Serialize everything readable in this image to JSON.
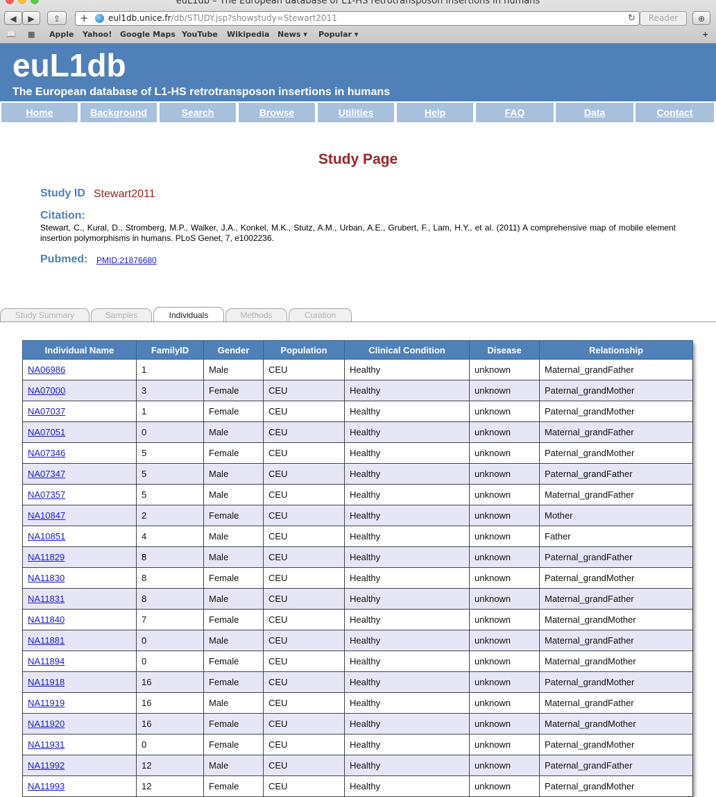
{
  "browser": {
    "window_title": "euL1db – The European database of L1-HS retrotransposon insertions in humans",
    "url_host": "eul1db.unice.fr",
    "url_path": "/db/STUDY.jsp?showstudy=Stewart2011",
    "reader_label": "Reader",
    "bookmarks": [
      "Apple",
      "Yahoo!",
      "Google Maps",
      "YouTube",
      "Wikipedia",
      "News ▾",
      "Popular ▾"
    ]
  },
  "site": {
    "logo": "euL1db",
    "tagline": "The European database of L1-HS retrotransposon insertions in humans"
  },
  "nav": [
    "Home",
    "Background",
    "Search",
    "Browse",
    "Utilities",
    "Help",
    "FAQ",
    "Data",
    "Contact"
  ],
  "study": {
    "page_title": "Study Page",
    "id_label": "Study ID",
    "id_value": "Stewart2011",
    "citation_label": "Citation:",
    "citation_text": "Stewart, C., Kural, D., Stromberg, M.P., Walker, J.A., Konkel, M.K., Stutz, A.M., Urban, A.E., Grubert, F., Lam, H.Y., et al. (2011) A comprehensive map of mobile element insertion polymorphisms in humans. PLoS Genet, 7, e1002236.",
    "pubmed_label": "Pubmed:",
    "pubmed_link": "PMID:21876680"
  },
  "tabs": [
    {
      "label": "Study Summary",
      "active": false
    },
    {
      "label": "Samples",
      "active": false
    },
    {
      "label": "Individuals",
      "active": true
    },
    {
      "label": "Methods",
      "active": false
    },
    {
      "label": "Curation",
      "active": false
    }
  ],
  "table": {
    "columns": [
      "Individual Name",
      "FamilyID",
      "Gender",
      "Population",
      "Clinical Condition",
      "Disease",
      "Relationship"
    ],
    "rows": [
      [
        "NA06986",
        "1",
        "Male",
        "CEU",
        "Healthy",
        "unknown",
        "Maternal_grandFather"
      ],
      [
        "NA07000",
        "3",
        "Female",
        "CEU",
        "Healthy",
        "unknown",
        "Paternal_grandMother"
      ],
      [
        "NA07037",
        "1",
        "Female",
        "CEU",
        "Healthy",
        "unknown",
        "Paternal_grandMother"
      ],
      [
        "NA07051",
        "0",
        "Male",
        "CEU",
        "Healthy",
        "unknown",
        "Maternal_grandFather"
      ],
      [
        "NA07346",
        "5",
        "Female",
        "CEU",
        "Healthy",
        "unknown",
        "Paternal_grandMother"
      ],
      [
        "NA07347",
        "5",
        "Male",
        "CEU",
        "Healthy",
        "unknown",
        "Paternal_grandFather"
      ],
      [
        "NA07357",
        "5",
        "Male",
        "CEU",
        "Healthy",
        "unknown",
        "Maternal_grandFather"
      ],
      [
        "NA10847",
        "2",
        "Female",
        "CEU",
        "Healthy",
        "unknown",
        "Mother"
      ],
      [
        "NA10851",
        "4",
        "Male",
        "CEU",
        "Healthy",
        "unknown",
        "Father"
      ],
      [
        "NA11829",
        "8",
        "Male",
        "CEU",
        "Healthy",
        "unknown",
        "Paternal_grandFather"
      ],
      [
        "NA11830",
        "8",
        "Female",
        "CEU",
        "Healthy",
        "unknown",
        "Paternal_grandMother"
      ],
      [
        "NA11831",
        "8",
        "Male",
        "CEU",
        "Healthy",
        "unknown",
        "Maternal_grandFather"
      ],
      [
        "NA11840",
        "7",
        "Female",
        "CEU",
        "Healthy",
        "unknown",
        "Maternal_grandMother"
      ],
      [
        "NA11881",
        "0",
        "Male",
        "CEU",
        "Healthy",
        "unknown",
        "Maternal_grandFather"
      ],
      [
        "NA11894",
        "0",
        "Female",
        "CEU",
        "Healthy",
        "unknown",
        "Maternal_grandMother"
      ],
      [
        "NA11918",
        "16",
        "Female",
        "CEU",
        "Healthy",
        "unknown",
        "Paternal_grandMother"
      ],
      [
        "NA11919",
        "16",
        "Male",
        "CEU",
        "Healthy",
        "unknown",
        "Maternal_grandFather"
      ],
      [
        "NA11920",
        "16",
        "Female",
        "CEU",
        "Healthy",
        "unknown",
        "Maternal_grandMother"
      ],
      [
        "NA11931",
        "0",
        "Female",
        "CEU",
        "Healthy",
        "unknown",
        "Paternal_grandMother"
      ],
      [
        "NA11992",
        "12",
        "Male",
        "CEU",
        "Healthy",
        "unknown",
        "Paternal_grandFather"
      ],
      [
        "NA11993",
        "12",
        "Female",
        "CEU",
        "Healthy",
        "unknown",
        "Paternal_grandMother"
      ]
    ]
  },
  "colors": {
    "header_blue": "#4f81b8",
    "nav_blue": "#a7c0db",
    "title_red": "#9b2424",
    "row_alt": "#e6e6f7",
    "link": "#1a1ad0"
  }
}
